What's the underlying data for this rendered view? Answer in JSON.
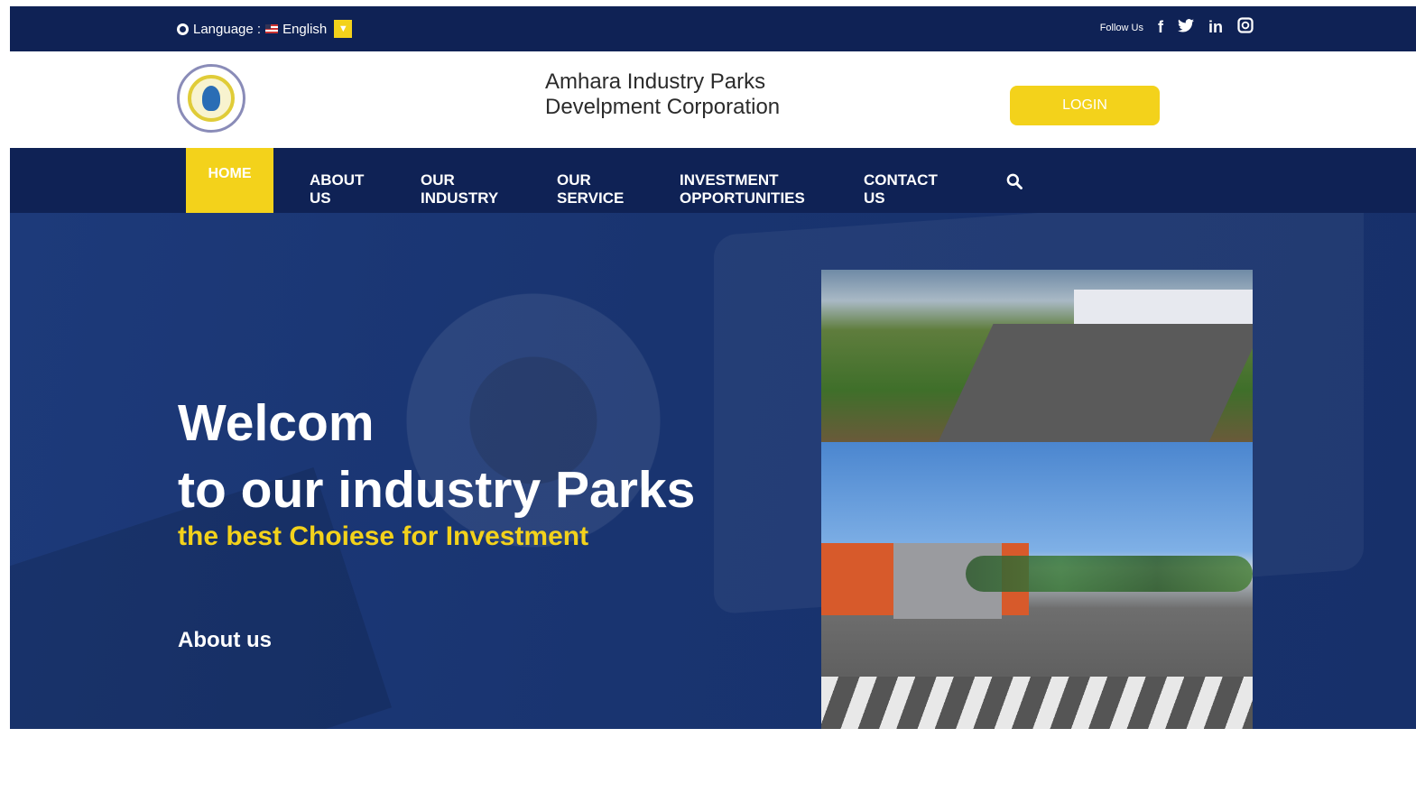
{
  "topbar": {
    "language_label": "Language :",
    "language_value": "English",
    "follow_label": "Follow Us",
    "social": [
      "f",
      "t",
      "in",
      "ig"
    ]
  },
  "header": {
    "brand_line1": "Amhara Industry Parks",
    "brand_line2": "Develpment Corporation",
    "login_label": "LOGIN"
  },
  "nav": {
    "items": [
      {
        "label": "HOME"
      },
      {
        "label": "ABOUT US"
      },
      {
        "label": "OUR INDUSTRY"
      },
      {
        "label": "OUR SERVICE"
      },
      {
        "label": "INVESTMENT OPPORTUNITIES"
      },
      {
        "label": "CONTACT US"
      }
    ]
  },
  "hero": {
    "title_line1": "Welcom",
    "title_line2": "to our industry Parks",
    "tagline": "the best Choiese for Investment",
    "about_link": "About us"
  },
  "colors": {
    "navy": "#0f2255",
    "accent_yellow": "#f3d21b",
    "hero_blue": "#1d3a7a"
  }
}
